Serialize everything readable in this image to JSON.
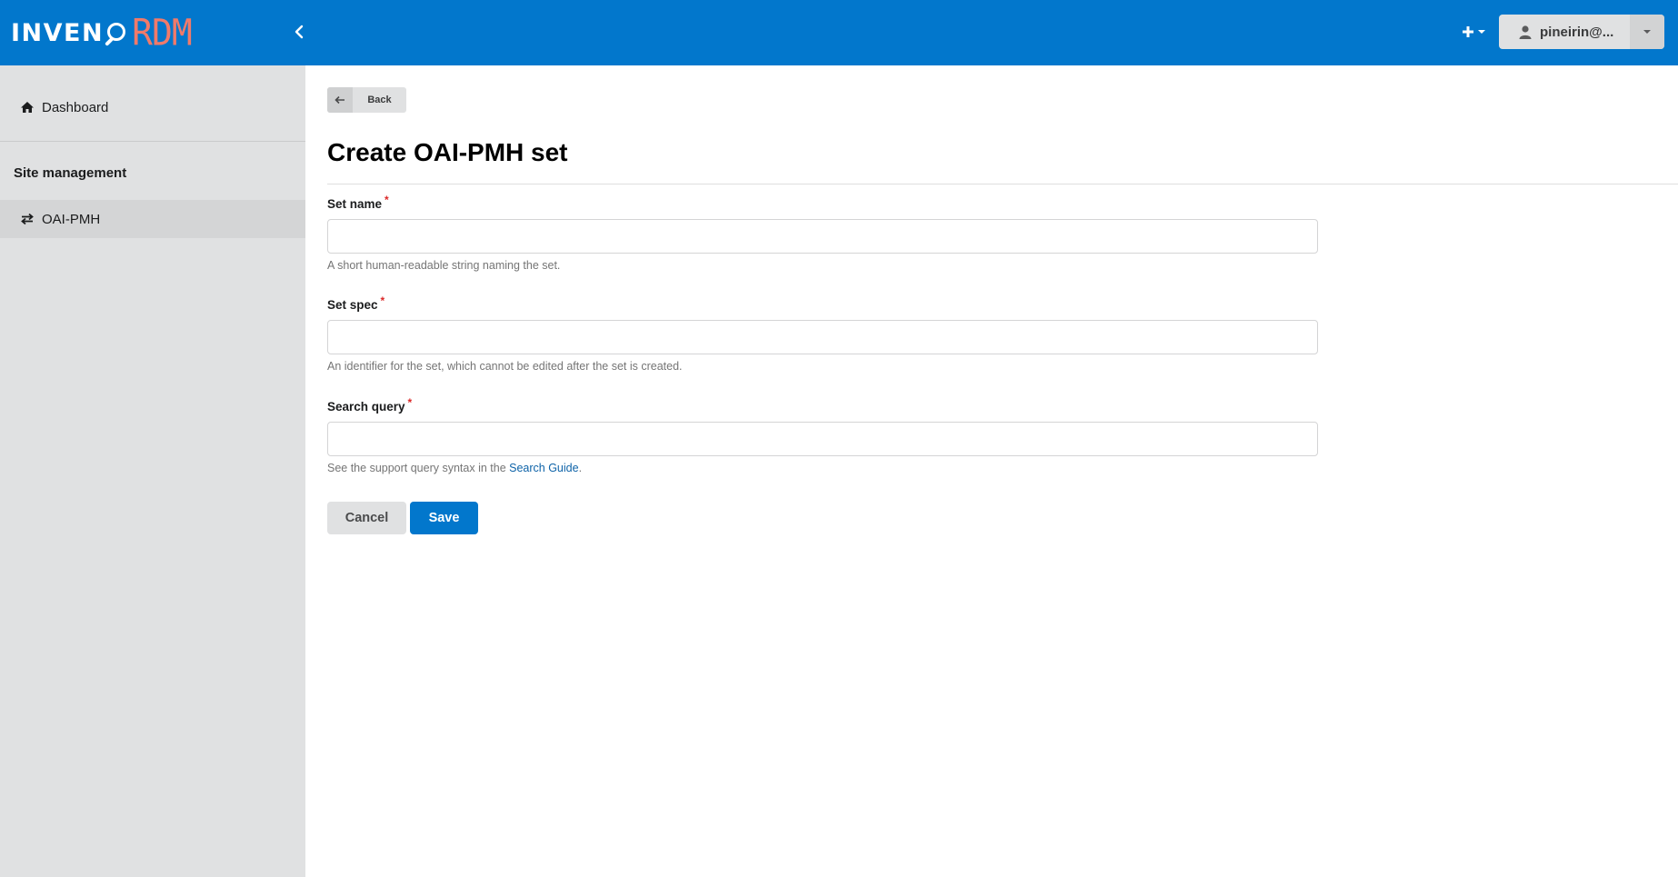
{
  "header": {
    "logo_left": "INVEN",
    "logo_right": "RDM",
    "user_label": "pineirin@...",
    "colors": {
      "bar": "#0277cc",
      "logo_accent": "#f07a6a"
    }
  },
  "sidebar": {
    "dashboard_label": "Dashboard",
    "section_heading": "Site management",
    "items": [
      {
        "label": "OAI-PMH",
        "icon": "exchange-icon",
        "active": true
      }
    ]
  },
  "main": {
    "back_label": "Back",
    "title": "Create OAI-PMH set",
    "fields": [
      {
        "label": "Set name",
        "required_mark": "*",
        "value": "",
        "help": "A short human-readable string naming the set."
      },
      {
        "label": "Set spec",
        "required_mark": "*",
        "value": "",
        "help": "An identifier for the set, which cannot be edited after the set is created."
      },
      {
        "label": "Search query",
        "required_mark": "*",
        "value": "",
        "help_prefix": "See the support query syntax in the ",
        "help_link": "Search Guide",
        "help_suffix": "."
      }
    ],
    "cancel_label": "Cancel",
    "save_label": "Save"
  }
}
